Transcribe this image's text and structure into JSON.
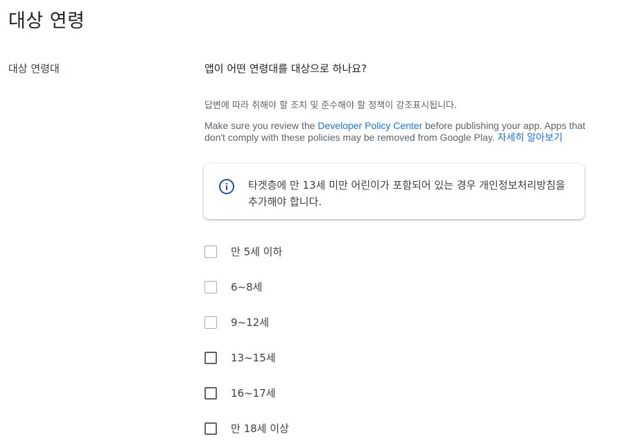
{
  "page": {
    "title": "대상 연령"
  },
  "section": {
    "label": "대상 연령대"
  },
  "question": "앱이 어떤 연령대를 대상으로 하나요?",
  "helper_text": "답변에 따라 취해야 할 조치 및 준수해야 할 정책이 강조표시됩니다.",
  "policy": {
    "prefix": "Make sure you review the ",
    "link_label": "Developer Policy Center",
    "suffix": " before publishing your app. Apps that don't comply with these policies may be removed from Google Play. ",
    "learn_more_label": "자세히 알아보기",
    "link_color": "#1a73e8"
  },
  "info_card": {
    "icon": "info-icon",
    "text": "타겟층에 만 13세 미만 어린이가 포함되어 있는 경우 개인정보처리방침을 추가해야 합니다.",
    "icon_color": "#174ea6"
  },
  "age_options": [
    {
      "label": "만 5세 이하",
      "checked": false
    },
    {
      "label": "6~8세",
      "checked": false
    },
    {
      "label": "9~12세",
      "checked": false
    },
    {
      "label": "13~15세",
      "checked": false
    },
    {
      "label": "16~17세",
      "checked": false
    },
    {
      "label": "만 18세 이상",
      "checked": false
    }
  ]
}
